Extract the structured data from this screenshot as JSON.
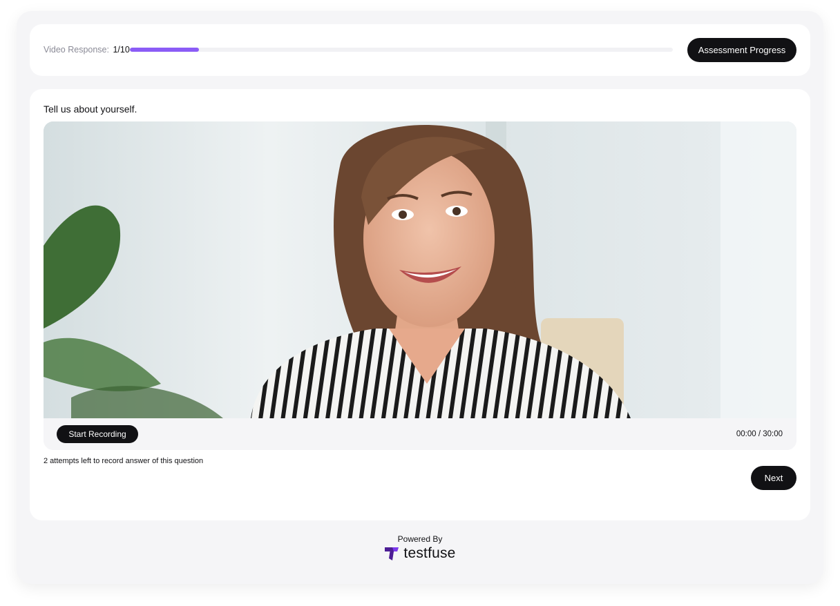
{
  "progress": {
    "label": "Video Response:",
    "count": "1/10",
    "value_fraction": 0.127,
    "accent_color": "#8b5cf6",
    "assessment_button_label": "Assessment Progress"
  },
  "question": {
    "text": "Tell us about yourself."
  },
  "video": {
    "record_button_label": "Start Recording",
    "timer": "00:00 / 30:00"
  },
  "attempts_text": "2 attempts left to record answer of this question",
  "next_label": "Next",
  "footer": {
    "powered_by": "Powered By",
    "brand_name": "testfuse",
    "brand_icon": "testfuse-logo-icon",
    "brand_color": "#5b21b6"
  }
}
